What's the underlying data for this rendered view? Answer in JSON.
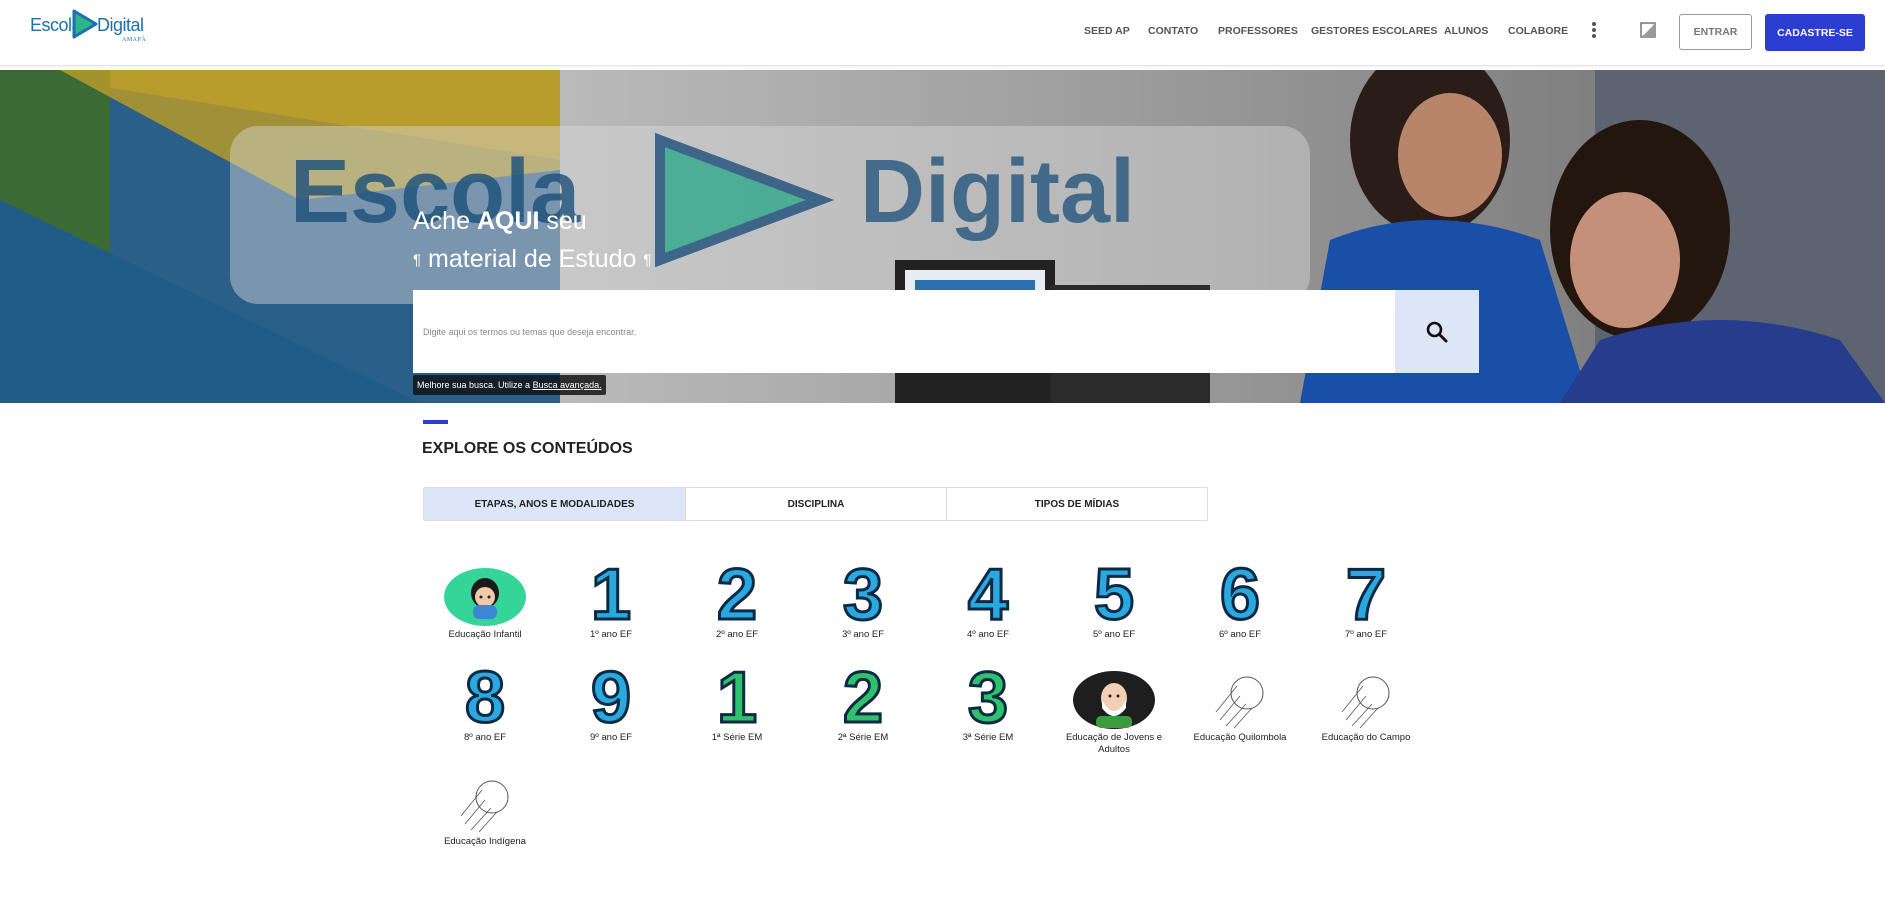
{
  "header": {
    "logo": {
      "word1": "Escola",
      "word2": "Digital",
      "sub": "AMAPÁ"
    },
    "nav": [
      "SEED AP",
      "CONTATO",
      "PROFESSORES",
      "GESTORES ESCOLARES",
      "ALUNOS",
      "COLABORE"
    ],
    "more_icon": "kebab-menu-icon",
    "contrast_icon": "contrast-icon",
    "login_label": "ENTRAR",
    "signup_label": "CADASTRE-SE",
    "signup_color": "#2b3ed0"
  },
  "hero": {
    "line1_pre": "Ache ",
    "line1_bold": "AQUI",
    "line1_post": " seu",
    "line2": "material de Estudo",
    "search_placeholder": "Digite aqui os termos ou temas que deseja encontrar.",
    "search_icon": "search-icon",
    "advanced_text": "Melhore sua busca. Utilize a ",
    "advanced_link": "Busca avançada."
  },
  "explore": {
    "title": "EXPLORE OS CONTEÚDOS",
    "tabs": [
      "ETAPAS, ANOS E MODALIDADES",
      "DISCIPLINA",
      "TIPOS DE MÍDIAS"
    ],
    "items": [
      {
        "label": "Educação Infantil",
        "glyph": ""
      },
      {
        "label": "1º ano EF",
        "glyph": "1"
      },
      {
        "label": "2º ano EF",
        "glyph": "2"
      },
      {
        "label": "3º ano EF",
        "glyph": "3"
      },
      {
        "label": "4º ano EF",
        "glyph": "4"
      },
      {
        "label": "5º ano EF",
        "glyph": "5"
      },
      {
        "label": "6º ano EF",
        "glyph": "6"
      },
      {
        "label": "7º ano EF",
        "glyph": "7"
      },
      {
        "label": "8º ano EF",
        "glyph": "8"
      },
      {
        "label": "9º ano EF",
        "glyph": "9"
      },
      {
        "label": "1ª Série EM",
        "glyph": "1"
      },
      {
        "label": "2ª Série EM",
        "glyph": "2"
      },
      {
        "label": "3ª Série EM",
        "glyph": "3"
      },
      {
        "label": "Educação de Jovens e Adultos",
        "glyph": ""
      },
      {
        "label": "Educação Quilombola",
        "glyph": ""
      },
      {
        "label": "Educação do Campo",
        "glyph": ""
      },
      {
        "label": "Educação Indígena",
        "glyph": ""
      }
    ]
  }
}
